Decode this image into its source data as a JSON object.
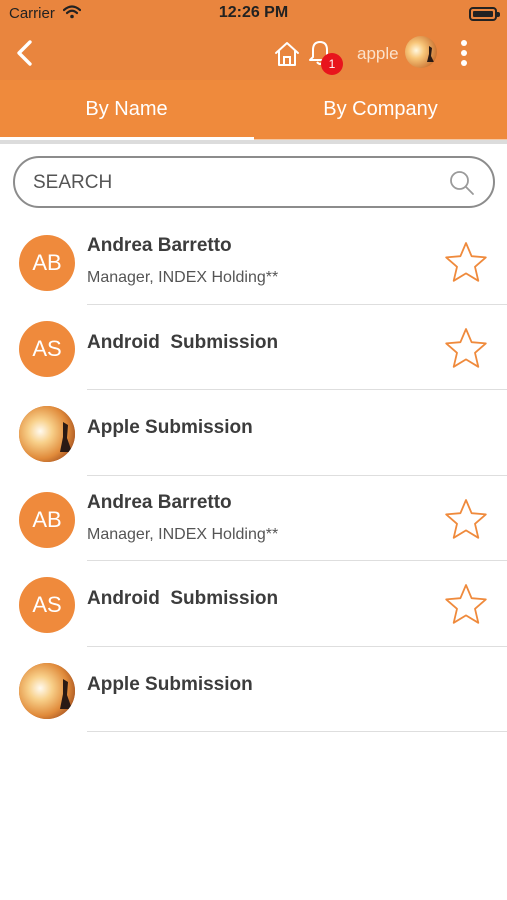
{
  "status_bar": {
    "carrier": "Carrier",
    "time": "12:26 PM"
  },
  "nav": {
    "user_name": "apple",
    "notification_count": "1"
  },
  "tabs": [
    {
      "label": "By Name",
      "active": true
    },
    {
      "label": "By Company",
      "active": false
    }
  ],
  "search": {
    "placeholder": "SEARCH",
    "value": ""
  },
  "contacts": [
    {
      "initials": "AB",
      "name": "Andrea Barretto",
      "subtitle": "Manager, INDEX Holding**",
      "favorite_star": true
    },
    {
      "initials": "AS",
      "name": "Android  Submission",
      "subtitle": "",
      "favorite_star": true
    },
    {
      "initials": "",
      "name": "Apple Submission",
      "subtitle": "",
      "favorite_star": false,
      "photo_avatar": true
    },
    {
      "initials": "AB",
      "name": "Andrea Barretto",
      "subtitle": "Manager, INDEX Holding**",
      "favorite_star": true
    },
    {
      "initials": "AS",
      "name": "Android  Submission",
      "subtitle": "",
      "favorite_star": true
    },
    {
      "initials": "",
      "name": "Apple Submission",
      "subtitle": "",
      "favorite_star": false,
      "photo_avatar": true
    }
  ],
  "colors": {
    "header": "#e9853e",
    "tab_bar": "#ef8a3c",
    "accent": "#ef8a3c",
    "badge": "#e8141c"
  },
  "icons": [
    "back-icon",
    "home-icon",
    "bell-icon",
    "more-vertical-icon",
    "search-icon",
    "star-outline-icon",
    "wifi-icon",
    "battery-icon"
  ]
}
